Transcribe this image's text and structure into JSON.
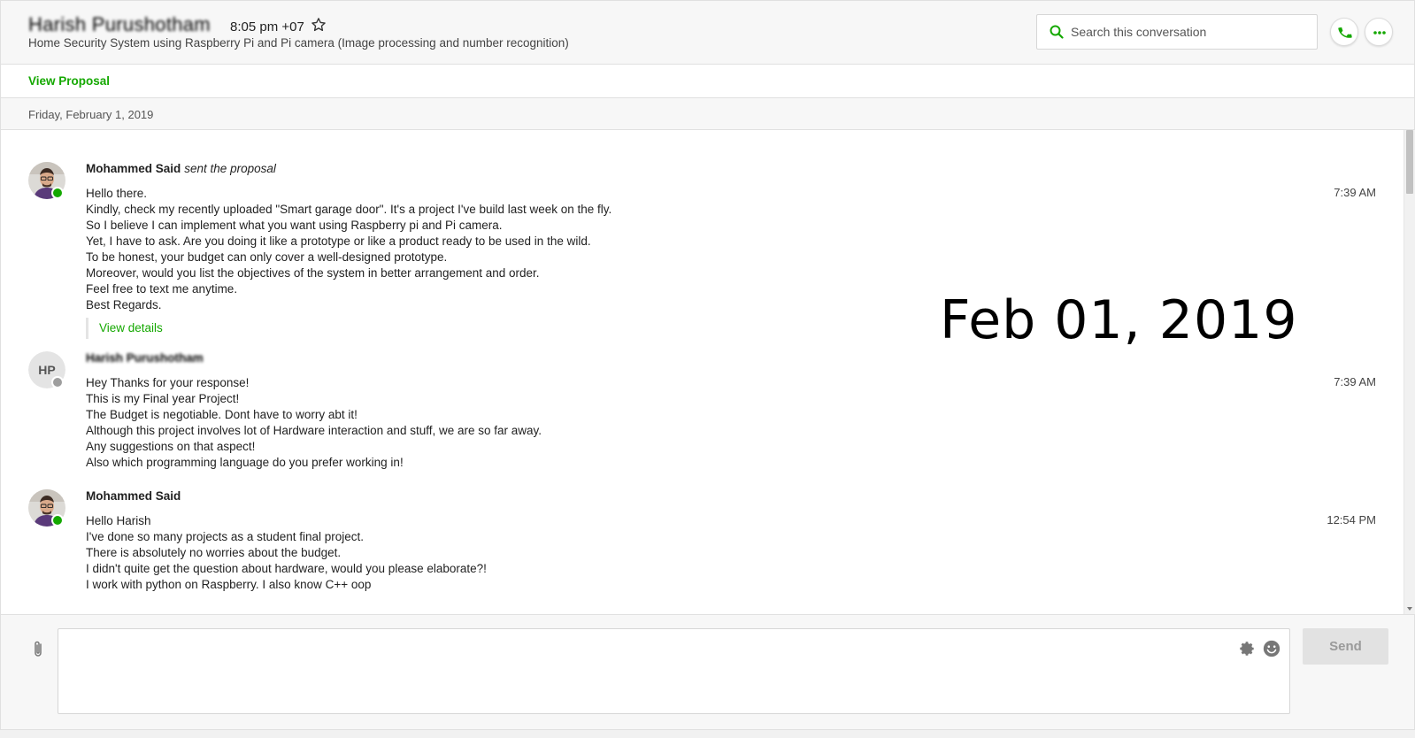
{
  "header": {
    "contact_name": "Harish Purushotham",
    "local_time": "8:05 pm +07",
    "subtitle": "Home Security System using Raspberry Pi and Pi camera (Image processing and number recognition)",
    "search_placeholder": "Search this conversation"
  },
  "proposal_bar": {
    "link_label": "View Proposal"
  },
  "date_bar": {
    "date": "Friday, February 1, 2019"
  },
  "messages": [
    {
      "sender": "Mohammed Said",
      "action": "sent the proposal",
      "time": "7:39 AM",
      "status": "online",
      "lines": [
        "Hello there.",
        "Kindly, check my recently uploaded \"Smart garage door\". It's a project I've build last week on the fly.",
        "So I believe I can implement what you want using Raspberry pi and Pi camera.",
        "Yet, I have to ask. Are you doing it like a prototype or like a product ready to be used in the wild.",
        "To be honest, your budget can only cover a well-designed prototype.",
        "Moreover, would you list the objectives of the system in better arrangement and order.",
        "Feel free to text me anytime.",
        "Best Regards."
      ],
      "details_label": "View details"
    },
    {
      "sender": "Harish Purushotham",
      "initials": "HP",
      "time": "7:39 AM",
      "status": "offline",
      "lines": [
        "Hey Thanks for your response!",
        "This is my Final year Project!",
        "The Budget is negotiable. Dont have to worry abt it!",
        "Although this project involves lot of Hardware interaction and stuff, we are so far away.",
        "Any suggestions on that aspect!",
        "Also which programming language do you prefer working in!"
      ]
    },
    {
      "sender": "Mohammed Said",
      "time": "12:54 PM",
      "status": "online",
      "lines": [
        "Hello Harish",
        "I've done so many projects as a student final project.",
        "There is absolutely no worries about the budget.",
        "I didn't quite get the question about hardware, would you please elaborate?!",
        "I work with python on Raspberry. I also know C++ oop"
      ]
    }
  ],
  "overlay_date": "Feb 01, 2019",
  "composer": {
    "send_label": "Send"
  },
  "colors": {
    "accent_green": "#14a800",
    "online_dot": "#14a800",
    "offline_dot": "#9e9e9e"
  },
  "icons": {
    "favorite": "star-icon",
    "search": "search-icon",
    "call": "phone-icon",
    "more": "more-icon",
    "attach": "paperclip-icon",
    "settings": "gear-icon",
    "emoji": "smiley-icon"
  }
}
